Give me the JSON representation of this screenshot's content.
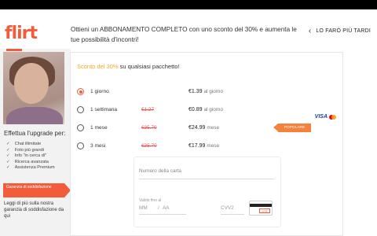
{
  "app": {
    "logo_text": "flirt",
    "brand_color": "#f25c3b"
  },
  "header": {
    "headline": "Ottieni un ABBONAMENTO COMPLETO con uno sconto del 30% e aumenta le tue possibilità d'incontri!",
    "later_label": "LO FARÒ PIÙ TARDI"
  },
  "sidebar": {
    "upgrade_title": "Effettua l'upgrade per:",
    "features": [
      "Chat illimitate",
      "Foto più grandi",
      "Info \"in cerca di\"",
      "Ricerca avanzata",
      "Assistenza Premium"
    ],
    "guarantee_badge": "Garanzia di soddisfazione",
    "guarantee_text": "Leggi di più sulla nostra garanzia di soddisfazione da qui"
  },
  "offer": {
    "discount_highlight": "Sconto del 30%",
    "discount_rest": " su qualsiasi pacchetto!",
    "plans": [
      {
        "label": "1 giorno",
        "old_price": "",
        "price": "€1.39",
        "unit": "al giorno",
        "selected": true
      },
      {
        "label": "1 settimana",
        "old_price": "€1.27",
        "price": "€0.89",
        "unit": "al giorno",
        "selected": false
      },
      {
        "label": "1 mese",
        "old_price": "€35.70",
        "price": "€24.99",
        "unit": "mese",
        "selected": false,
        "badge": "POPOLARE"
      },
      {
        "label": "3 mesi",
        "old_price": "€25.70",
        "price": "€17.99",
        "unit": "mese",
        "selected": false
      }
    ]
  },
  "payment": {
    "brands": [
      "VISA",
      "mastercard"
    ],
    "card_number_placeholder": "Numero della carta",
    "valid_label": "Valido fino al",
    "mm_placeholder": "MM",
    "slash": "/",
    "aa_placeholder": "AA",
    "cvv_placeholder": "CVV2",
    "cvv_hint": "275"
  }
}
